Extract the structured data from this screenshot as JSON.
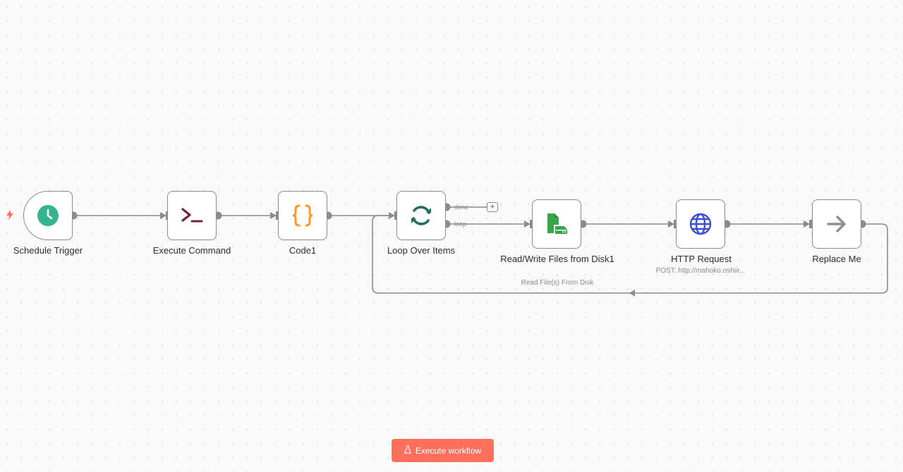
{
  "nodes": {
    "schedule_trigger": {
      "label": "Schedule Trigger",
      "icon": "clock-icon",
      "color": "#35b58f"
    },
    "execute_command": {
      "label": "Execute Command",
      "icon": "terminal-icon",
      "color": "#7a1f3d"
    },
    "code1": {
      "label": "Code1",
      "icon": "braces-icon",
      "color": "#ff9922"
    },
    "loop_over_items": {
      "label": "Loop Over Items",
      "icon": "refresh-icon",
      "color": "#1f6f5e",
      "output_done": "done",
      "output_loop": "loop"
    },
    "read_write_files": {
      "label": "Read/Write Files from Disk1",
      "subtitle": "Read File(s) From Disk",
      "icon": "file-drive-icon",
      "color": "#3aa548"
    },
    "http_request": {
      "label": "HTTP Request",
      "subtitle": "POST: http://mahoko.oshiir...",
      "icon": "globe-icon",
      "color": "#3b4ed8"
    },
    "replace_me": {
      "label": "Replace Me",
      "icon": "arrow-right-icon",
      "color": "#8f8f95"
    }
  },
  "add_node_button": "+",
  "execute_button": {
    "label": "Execute workflow",
    "icon": "flask-icon",
    "color": "#ff6f5c"
  },
  "trigger_indicator": {
    "icon": "bolt-icon",
    "color": "#ff6f5c"
  }
}
